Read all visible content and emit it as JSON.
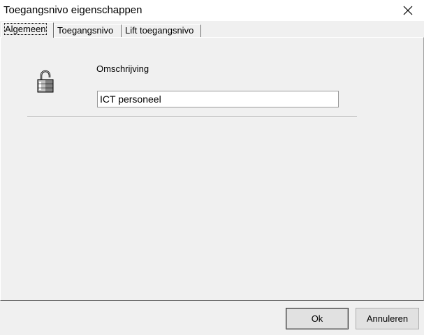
{
  "window": {
    "title": "Toegangsnivo eigenschappen",
    "close_icon": "close-icon"
  },
  "tabs": [
    {
      "label": "Algemeen",
      "active": true
    },
    {
      "label": "Toegangsnivo",
      "active": false
    },
    {
      "label": "Lift toegangsnivo",
      "active": false
    }
  ],
  "general": {
    "icon": "padlock-icon",
    "description_label": "Omschrijving",
    "description_value": "ICT personeel"
  },
  "buttons": {
    "ok_label": "Ok",
    "cancel_label": "Annuleren"
  }
}
